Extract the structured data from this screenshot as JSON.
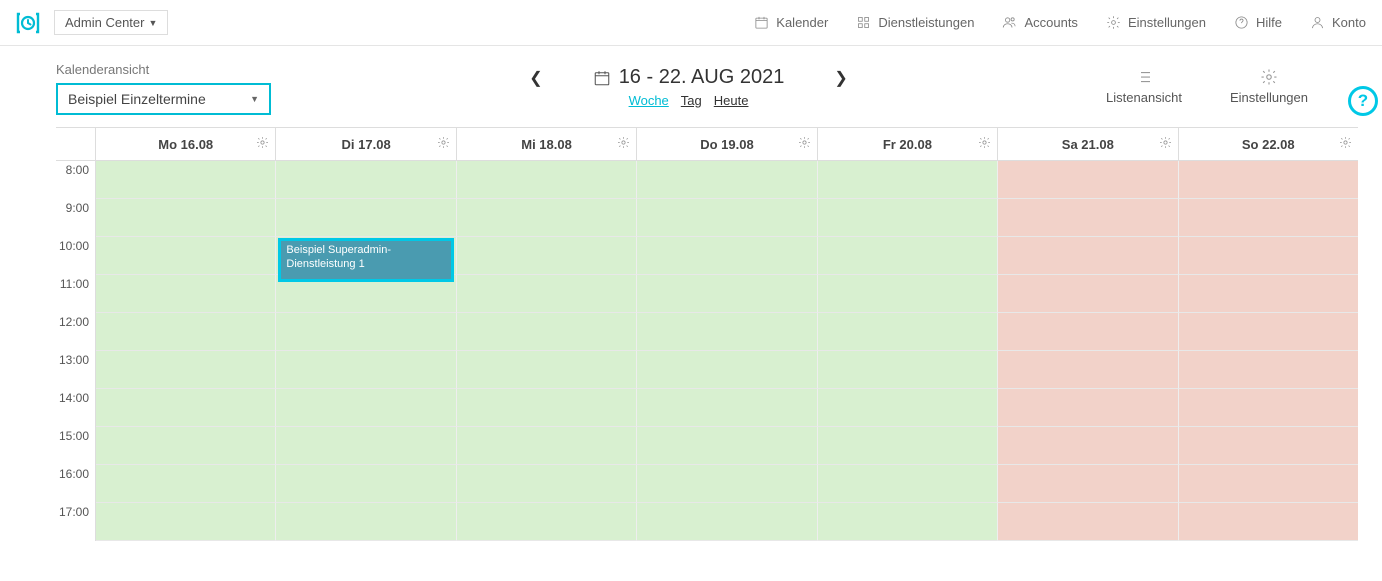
{
  "topbar": {
    "admin_dropdown": "Admin Center",
    "nav": {
      "kalender": "Kalender",
      "dienst": "Dienstleistungen",
      "accounts": "Accounts",
      "einstell": "Einstellungen",
      "hilfe": "Hilfe",
      "konto": "Konto"
    }
  },
  "subhead": {
    "cal_label": "Kalenderansicht",
    "cal_selected": "Beispiel Einzeltermine",
    "date_range": "16 - 22. AUG 2021",
    "view_week": "Woche",
    "view_day": "Tag",
    "view_today": "Heute",
    "tool_list": "Listenansicht",
    "tool_settings": "Einstellungen"
  },
  "calendar": {
    "days": [
      "Mo 16.08",
      "Di 17.08",
      "Mi 18.08",
      "Do 19.08",
      "Fr 20.08",
      "Sa 21.08",
      "So 22.08"
    ],
    "times": [
      "8:00",
      "9:00",
      "10:00",
      "11:00",
      "12:00",
      "13:00",
      "14:00",
      "15:00",
      "16:00",
      "17:00"
    ],
    "weekend_indices": [
      5,
      6
    ],
    "event": {
      "day_index": 1,
      "time_index": 2,
      "label": "Beispiel Superadmin-Dienstleistung 1"
    }
  },
  "help_float": "?"
}
